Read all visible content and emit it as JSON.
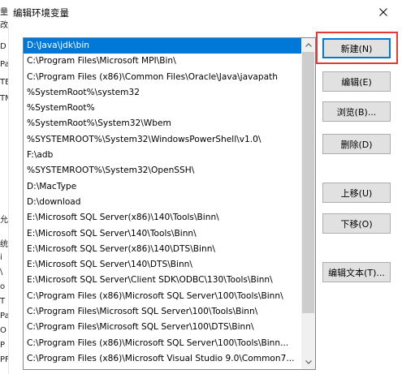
{
  "window": {
    "title": "编辑环境变量",
    "close_icon": "close-icon"
  },
  "background_fragments": [
    "量",
    "改",
    "D",
    "Pa",
    "TE",
    "TM",
    "允",
    "统",
    "i",
    "\\",
    "o",
    "T",
    "Pa",
    "O",
    "P",
    "PF"
  ],
  "path_list": {
    "selected_index": 0,
    "items": [
      "D:\\Java\\jdk\\bin",
      "C:\\Program Files\\Microsoft MPI\\Bin\\",
      "C:\\Program Files (x86)\\Common Files\\Oracle\\Java\\javapath",
      "%SystemRoot%\\system32",
      "%SystemRoot%",
      "%SystemRoot%\\System32\\Wbem",
      "%SYSTEMROOT%\\System32\\WindowsPowerShell\\v1.0\\",
      "F:\\adb",
      "%SYSTEMROOT%\\System32\\OpenSSH\\",
      "D:\\MacType",
      "D:\\download",
      "E:\\Microsoft SQL Server(x86)\\140\\Tools\\Binn\\",
      "E:\\Microsoft SQL Server\\140\\Tools\\Binn\\",
      "E:\\Microsoft SQL Server(x86)\\140\\DTS\\Binn\\",
      "E:\\Microsoft SQL Server\\140\\DTS\\Binn\\",
      "E:\\Microsoft SQL Server\\Client SDK\\ODBC\\130\\Tools\\Binn\\",
      "C:\\Program Files (x86)\\Microsoft SQL Server\\100\\Tools\\Binn\\",
      "C:\\Program Files\\Microsoft SQL Server\\100\\Tools\\Binn\\",
      "C:\\Program Files\\Microsoft SQL Server\\100\\DTS\\Binn\\",
      "C:\\Program Files (x86)\\Microsoft SQL Server\\100\\Tools\\Binn...",
      "C:\\Program Files (x86)\\Microsoft Visual Studio 9.0\\Common7..."
    ]
  },
  "buttons": {
    "new": "新建(N)",
    "edit": "编辑(E)",
    "browse": "浏览(B)...",
    "delete": "删除(D)",
    "move_up": "上移(U)",
    "move_down": "下移(O)",
    "edit_text": "编辑文本(T)..."
  },
  "colors": {
    "selection": "#0078d7",
    "highlight_box": "#e53935"
  }
}
